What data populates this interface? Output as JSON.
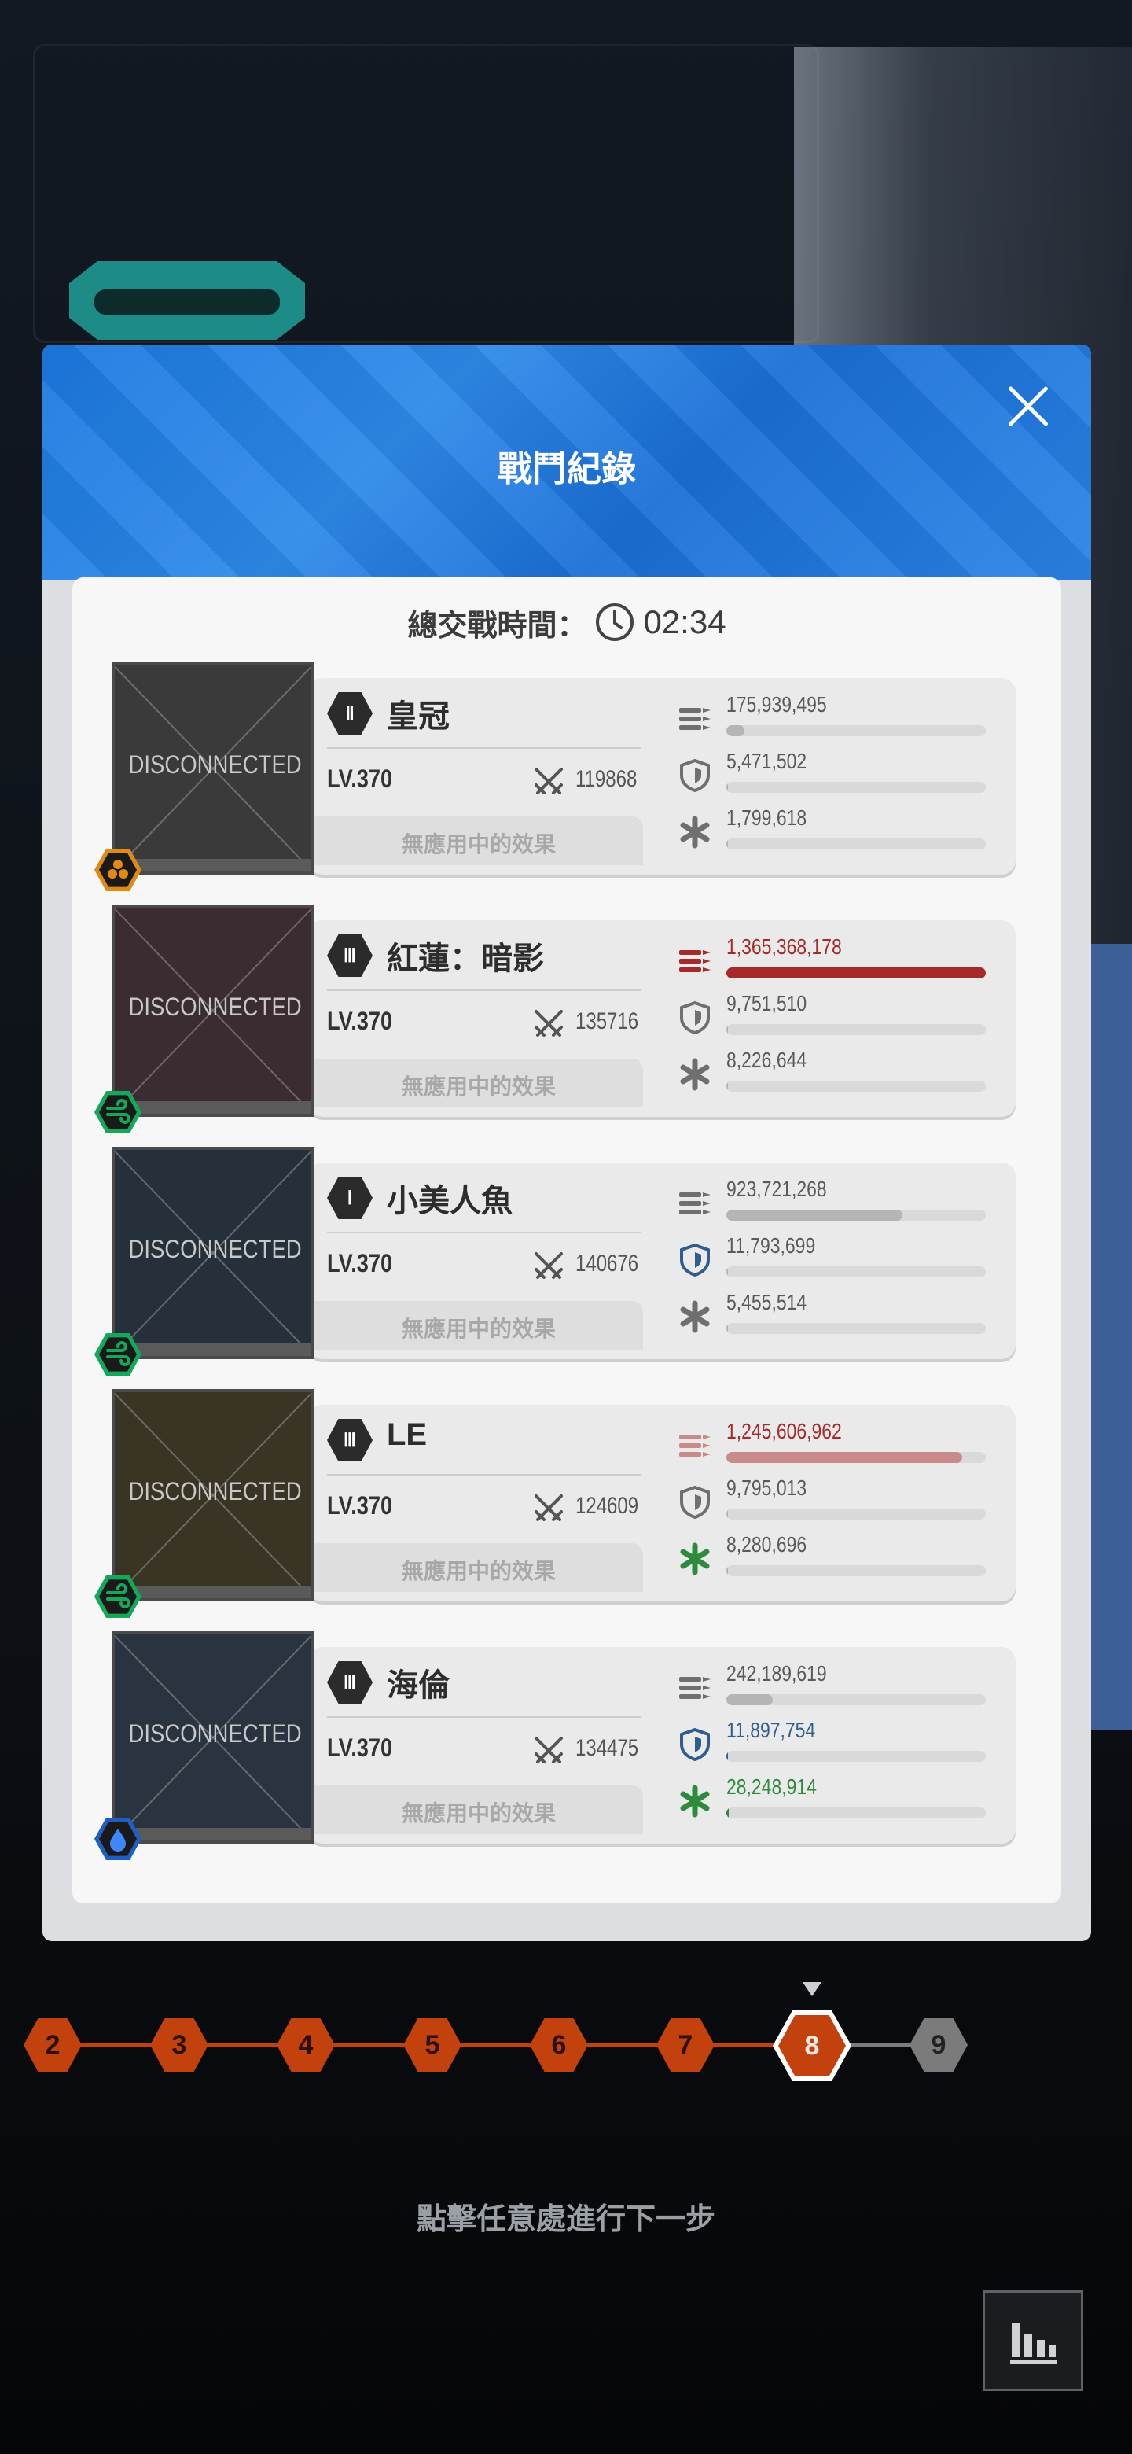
{
  "modal": {
    "title": "戰鬥紀錄",
    "total_time_label": "總交戰時間：",
    "total_time_value": "02:34"
  },
  "units": [
    {
      "rank": "Ⅱ",
      "name": "皇冠",
      "portrait_status": "DISCONNECTED",
      "level": "LV.370",
      "power": "119868",
      "effect": "無應用中的效果",
      "class_icon": "burst-class-icon",
      "class_color": "#e08a14",
      "stats": {
        "damage": "175,939,495",
        "damage_ratio": 0.07,
        "shield": "5,471,502",
        "shield_ratio": 0.0,
        "heal": "1,799,618",
        "heal_ratio": 0.0
      }
    },
    {
      "rank": "Ⅲ",
      "name": "紅蓮：暗影",
      "portrait_status": "DISCONNECTED",
      "level": "LV.370",
      "power": "135716",
      "effect": "無應用中的效果",
      "class_icon": "wind-element-icon",
      "class_color": "#14a85a",
      "stats": {
        "damage": "1,365,368,178",
        "damage_ratio": 1.0,
        "shield": "9,751,510",
        "shield_ratio": 0.0,
        "heal": "8,226,644",
        "heal_ratio": 0.0
      }
    },
    {
      "rank": "Ⅰ",
      "name": "小美人魚",
      "portrait_status": "DISCONNECTED",
      "level": "LV.370",
      "power": "140676",
      "effect": "無應用中的效果",
      "class_icon": "wind-element-icon",
      "class_color": "#14a85a",
      "stats": {
        "damage": "923,721,268",
        "damage_ratio": 0.68,
        "shield": "11,793,699",
        "shield_ratio": 0.0,
        "heal": "5,455,514",
        "heal_ratio": 0.0
      }
    },
    {
      "rank": "Ⅲ",
      "name": "LE",
      "portrait_status": "DISCONNECTED",
      "level": "LV.370",
      "power": "124609",
      "effect": "無應用中的效果",
      "class_icon": "wind-element-icon",
      "class_color": "#14a85a",
      "stats": {
        "damage": "1,245,606,962",
        "damage_ratio": 0.91,
        "shield": "9,795,013",
        "shield_ratio": 0.0,
        "heal": "8,280,696",
        "heal_ratio": 0.0
      }
    },
    {
      "rank": "Ⅲ",
      "name": "海倫",
      "portrait_status": "DISCONNECTED",
      "level": "LV.370",
      "power": "134475",
      "effect": "無應用中的效果",
      "class_icon": "water-element-icon",
      "class_color": "#1e5fc4",
      "stats": {
        "damage": "242,189,619",
        "damage_ratio": 0.18,
        "shield": "11,897,754",
        "shield_ratio": 0.0,
        "heal": "28,248,914",
        "heal_ratio": 0.01
      }
    }
  ],
  "progress": {
    "stages": [
      "2",
      "3",
      "4",
      "5",
      "6",
      "7",
      "8",
      "9"
    ],
    "current_stage": "8"
  },
  "footer": {
    "continue_hint": "點擊任意處進行下一步"
  },
  "colors": {
    "modal_header": "#1c78e0",
    "damage_top": "#a52a2a",
    "damage_high": "#c98a8a",
    "damage_normal": "#b5b5b5",
    "shield_top": "#2f5d8c",
    "heal_top": "#2e8b3e",
    "stage_done": "#c2410c",
    "stage_future": "#7b7b7b"
  }
}
